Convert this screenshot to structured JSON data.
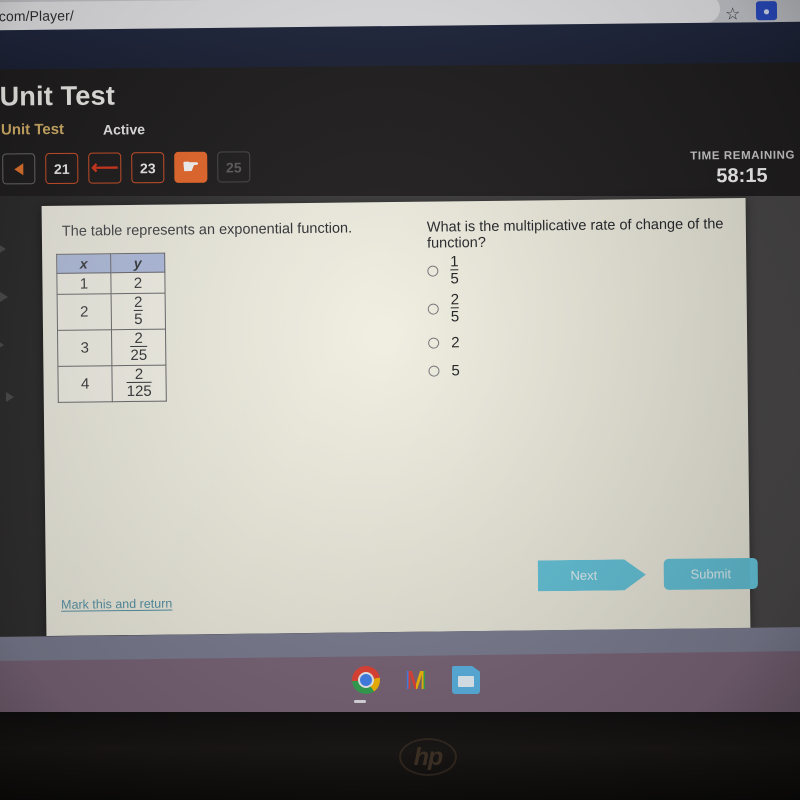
{
  "browser": {
    "url": "genuity.com/Player/",
    "bookmark_icon": "star-icon",
    "extension_icon": "extension-icon"
  },
  "app": {
    "title": "Unit Test",
    "breadcrumb_test": "Unit Test",
    "breadcrumb_state": "Active",
    "timer_label": "TIME REMAINING",
    "timer_value": "58:15"
  },
  "pager": {
    "prev_label": "",
    "items": [
      {
        "label": "21",
        "state": "answered"
      },
      {
        "label": "",
        "state": "flagged"
      },
      {
        "label": "23",
        "state": "answered"
      },
      {
        "label": "",
        "state": "current"
      },
      {
        "label": "25",
        "state": "future"
      }
    ]
  },
  "question": {
    "stem": "The table represents an exponential function.",
    "prompt": "What is the multiplicative rate of change of the function?",
    "table": {
      "headers": [
        "x",
        "y"
      ],
      "rows": [
        {
          "x": "1",
          "y_num": "2",
          "y_den": ""
        },
        {
          "x": "2",
          "y_num": "2",
          "y_den": "5"
        },
        {
          "x": "3",
          "y_num": "2",
          "y_den": "25"
        },
        {
          "x": "4",
          "y_num": "2",
          "y_den": "125"
        }
      ]
    },
    "options": [
      {
        "num": "1",
        "den": "5",
        "selected": false
      },
      {
        "num": "2",
        "den": "5",
        "selected": false
      },
      {
        "num": "2",
        "den": "",
        "selected": false
      },
      {
        "num": "5",
        "den": "",
        "selected": false
      }
    ]
  },
  "actions": {
    "mark_link": "Mark this and return",
    "next_label": "Next",
    "submit_label": "Submit"
  },
  "shelf": {
    "icons": [
      "chrome-icon",
      "gmail-icon",
      "google-slides-icon"
    ]
  },
  "device": {
    "brand": "hp"
  },
  "colors": {
    "panel_bg": "#f1efe1",
    "header_bg": "#201e1e",
    "accent_orange": "#ec6a2d",
    "flag_red": "#d6371f",
    "table_header": "#a9b8de",
    "button_teal": "#66c8de",
    "link_teal": "#4e8fa3",
    "crumb_gold": "#d8b36a"
  }
}
